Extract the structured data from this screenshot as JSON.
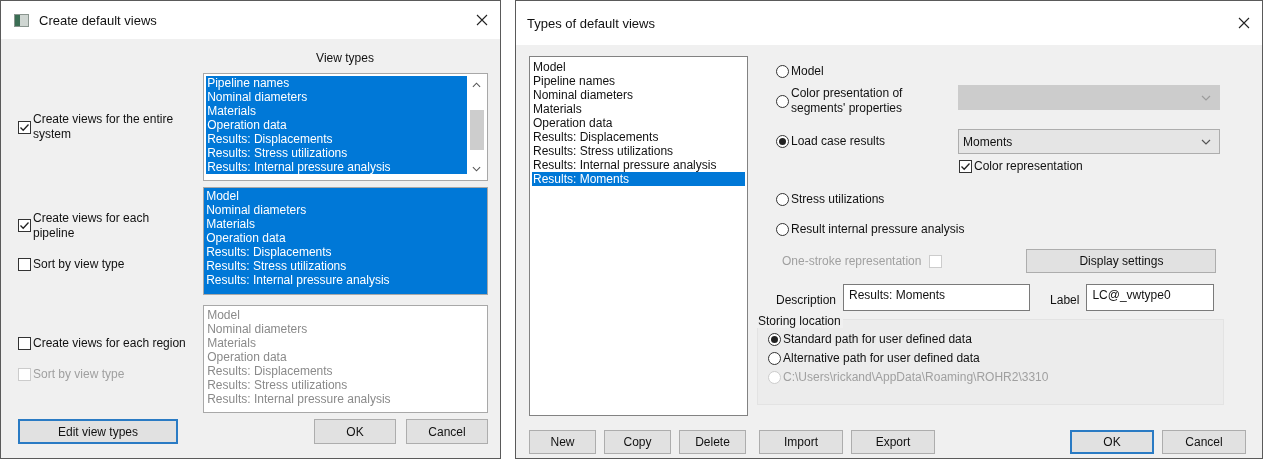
{
  "create_views_dialog": {
    "title": "Create default views",
    "column_header": "View types",
    "sections": [
      {
        "checkbox": {
          "label": "Create views for the entire system",
          "checked": true,
          "disabled": false
        },
        "list": {
          "disabled": false,
          "scrollable": true,
          "items": [
            {
              "label": "Pipeline names",
              "selected": true
            },
            {
              "label": "Nominal diameters",
              "selected": true
            },
            {
              "label": "Materials",
              "selected": true
            },
            {
              "label": "Operation data",
              "selected": true
            },
            {
              "label": "Results: Displacements",
              "selected": true
            },
            {
              "label": "Results: Stress utilizations",
              "selected": true
            },
            {
              "label": "Results: Internal pressure analysis",
              "selected": true
            }
          ]
        }
      },
      {
        "checkbox": {
          "label": "Create views for each pipeline",
          "checked": true,
          "disabled": false
        },
        "sort_checkbox": {
          "label": "Sort by view type",
          "checked": false,
          "disabled": false
        },
        "list": {
          "disabled": false,
          "scrollable": false,
          "items": [
            {
              "label": "Model",
              "selected": true
            },
            {
              "label": "Nominal diameters",
              "selected": true
            },
            {
              "label": "Materials",
              "selected": true
            },
            {
              "label": "Operation data",
              "selected": true
            },
            {
              "label": "Results: Displacements",
              "selected": true
            },
            {
              "label": "Results: Stress utilizations",
              "selected": true
            },
            {
              "label": "Results: Internal pressure analysis",
              "selected": true
            }
          ]
        }
      },
      {
        "checkbox": {
          "label": "Create views for each region",
          "checked": false,
          "disabled": false
        },
        "sort_checkbox": {
          "label": "Sort by view type",
          "checked": false,
          "disabled": true
        },
        "list": {
          "disabled": true,
          "scrollable": false,
          "items": [
            {
              "label": "Model",
              "selected": false
            },
            {
              "label": "Nominal diameters",
              "selected": false
            },
            {
              "label": "Materials",
              "selected": false
            },
            {
              "label": "Operation data",
              "selected": false
            },
            {
              "label": "Results: Displacements",
              "selected": false
            },
            {
              "label": "Results: Stress utilizations",
              "selected": false
            },
            {
              "label": "Results: Internal pressure analysis",
              "selected": false
            }
          ]
        }
      }
    ],
    "buttons": [
      {
        "label": "Edit view types",
        "focused": true
      },
      {
        "label": "OK",
        "focused": false
      },
      {
        "label": "Cancel",
        "focused": false
      }
    ]
  },
  "view_types_dialog": {
    "title": "Types of default views",
    "view_list": [
      {
        "label": "Model",
        "selected": false
      },
      {
        "label": "Pipeline names",
        "selected": false
      },
      {
        "label": "Nominal diameters",
        "selected": false
      },
      {
        "label": "Materials",
        "selected": false
      },
      {
        "label": "Operation data",
        "selected": false
      },
      {
        "label": "Results: Displacements",
        "selected": false
      },
      {
        "label": "Results: Stress utilizations",
        "selected": false
      },
      {
        "label": "Results: Internal pressure analysis",
        "selected": false
      },
      {
        "label": "Results: Moments",
        "selected": true
      }
    ],
    "options": [
      {
        "label": "Model",
        "selected": false
      },
      {
        "label": "Color presentation of segments' properties",
        "selected": false,
        "dropdown": {
          "disabled": true
        }
      },
      {
        "label": "Load case results",
        "selected": true,
        "dropdown": {
          "value": "Moments",
          "disabled": false
        },
        "checkbox": {
          "label": "Color representation",
          "checked": true
        }
      },
      {
        "label": "Stress utilizations",
        "selected": false
      },
      {
        "label": "Result internal pressure analysis",
        "selected": false
      }
    ],
    "one_stroke": {
      "label": "One-stroke representation",
      "checked": false,
      "disabled": true
    },
    "display_settings_button": "Display settings",
    "description": {
      "label": "Description",
      "value": "Results: Moments"
    },
    "label_field": {
      "label": "Label",
      "value": "LC@_vwtype0"
    },
    "storing_location": {
      "title": "Storing location",
      "options": [
        {
          "label": "Standard path for user defined data",
          "selected": true,
          "disabled": false
        },
        {
          "label": "Alternative path for user defined data",
          "selected": false,
          "disabled": false
        },
        {
          "label": "C:\\Users\\rickand\\AppData\\Roaming\\ROHR2\\3310",
          "selected": false,
          "disabled": true
        }
      ]
    },
    "left_buttons": [
      {
        "label": "New",
        "focused": false
      },
      {
        "label": "Copy",
        "focused": false
      },
      {
        "label": "Delete",
        "focused": false
      },
      {
        "label": "Import",
        "focused": false
      },
      {
        "label": "Export",
        "focused": false
      }
    ],
    "right_buttons": [
      {
        "label": "OK",
        "focused": true
      },
      {
        "label": "Cancel",
        "focused": false
      }
    ]
  }
}
